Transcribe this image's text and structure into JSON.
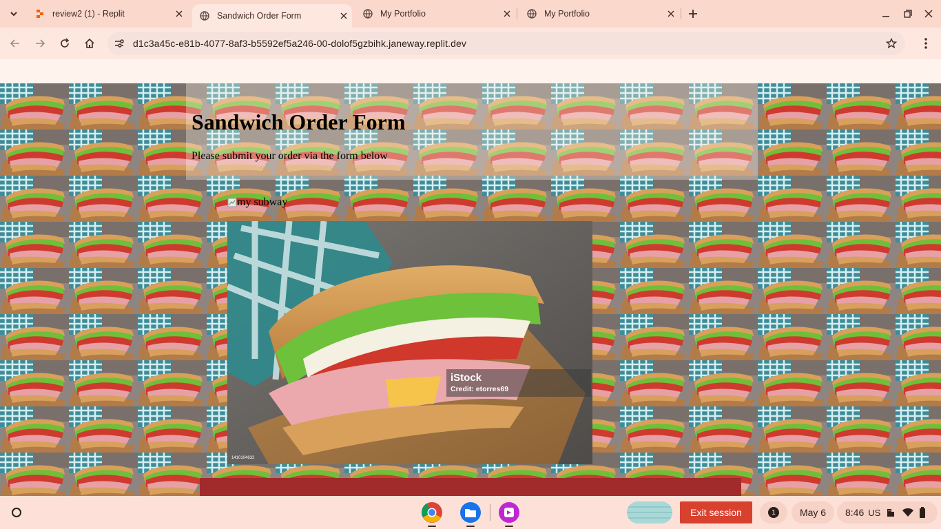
{
  "browser": {
    "tabs": [
      {
        "title": "review2 (1) - Replit",
        "favicon": "replit-icon",
        "active": false
      },
      {
        "title": "Sandwich Order Form",
        "favicon": "globe-icon",
        "active": true
      },
      {
        "title": "My Portfolio",
        "favicon": "globe-icon",
        "active": false
      },
      {
        "title": "My Portfolio",
        "favicon": "globe-icon",
        "active": false
      }
    ],
    "url": "d1c3a45c-e81b-4077-8af3-b5592ef5a246-00-dolof5gzbihk.janeway.replit.dev",
    "colors": {
      "tabstrip": "#fbd8cc",
      "toolbar": "#fde7df",
      "omnibox": "#f6e2dc"
    }
  },
  "page": {
    "title": "Sandwich Order Form",
    "subtitle": "Please submit your order via the form below",
    "broken_image_alt": "my subway",
    "hero_image": {
      "brand": "iStock",
      "credit": "Credit: etorres69",
      "stock_id": "1410104632"
    },
    "colors": {
      "footer_bar": "#a12a2a"
    }
  },
  "shelf": {
    "apps": [
      "chrome-icon",
      "files-icon",
      "screencast-icon"
    ],
    "notification_count": "1",
    "date": "May 6",
    "time": "8:46",
    "locale": "US",
    "exit_label": "Exit session",
    "colors": {
      "exit": "#d9412f"
    }
  }
}
